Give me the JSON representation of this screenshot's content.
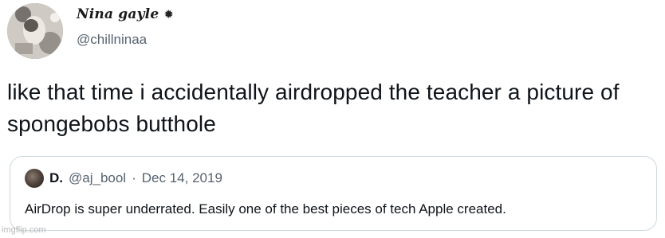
{
  "author": {
    "display_name": "Nina gayle",
    "name_icon": "sparkle-icon",
    "handle": "@chillninaa",
    "avatar": "profile-photo"
  },
  "tweet": {
    "text": "like that time i accidentally airdropped the teacher a picture of spongebobs butthole"
  },
  "quoted_tweet": {
    "display_name": "D.",
    "handle": "@aj_bool",
    "separator": "·",
    "date": "Dec 14, 2019",
    "text": "AirDrop is super underrated. Easily one of the best pieces of tech Apple created."
  },
  "watermark": "imgflip.com",
  "colors": {
    "text_primary": "#0f1419",
    "text_secondary": "#566370",
    "card_border": "#cfd9de",
    "background": "#ffffff"
  }
}
